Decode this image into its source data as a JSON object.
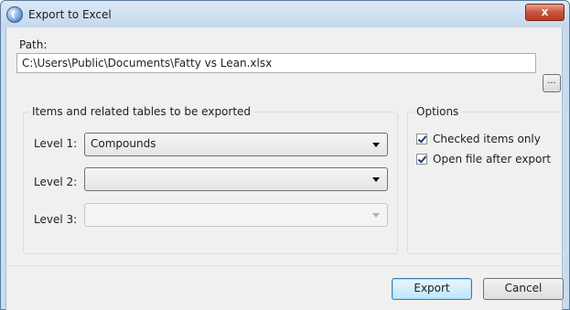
{
  "window": {
    "title": "Export to Excel",
    "close_label": "x"
  },
  "path": {
    "label": "Path:",
    "value": "C:\\Users\\Public\\Documents\\Fatty vs Lean.xlsx",
    "browse_label": "..."
  },
  "items_group": {
    "title": "Items and related tables to be exported",
    "levels": [
      {
        "label": "Level 1:",
        "value": "Compounds",
        "enabled": true
      },
      {
        "label": "Level 2:",
        "value": "",
        "enabled": true
      },
      {
        "label": "Level 3:",
        "value": "",
        "enabled": false
      }
    ]
  },
  "options_group": {
    "title": "Options",
    "checkboxes": [
      {
        "label": "Checked items only",
        "checked": true
      },
      {
        "label": "Open file after export",
        "checked": true
      }
    ]
  },
  "buttons": {
    "export_label": "Export",
    "cancel_label": "Cancel"
  },
  "colors": {
    "titlebar": "#c4d8ec",
    "client_bg": "#f0f0f0",
    "close_button": "#c9533d",
    "default_button_border": "#3c7fb1"
  }
}
